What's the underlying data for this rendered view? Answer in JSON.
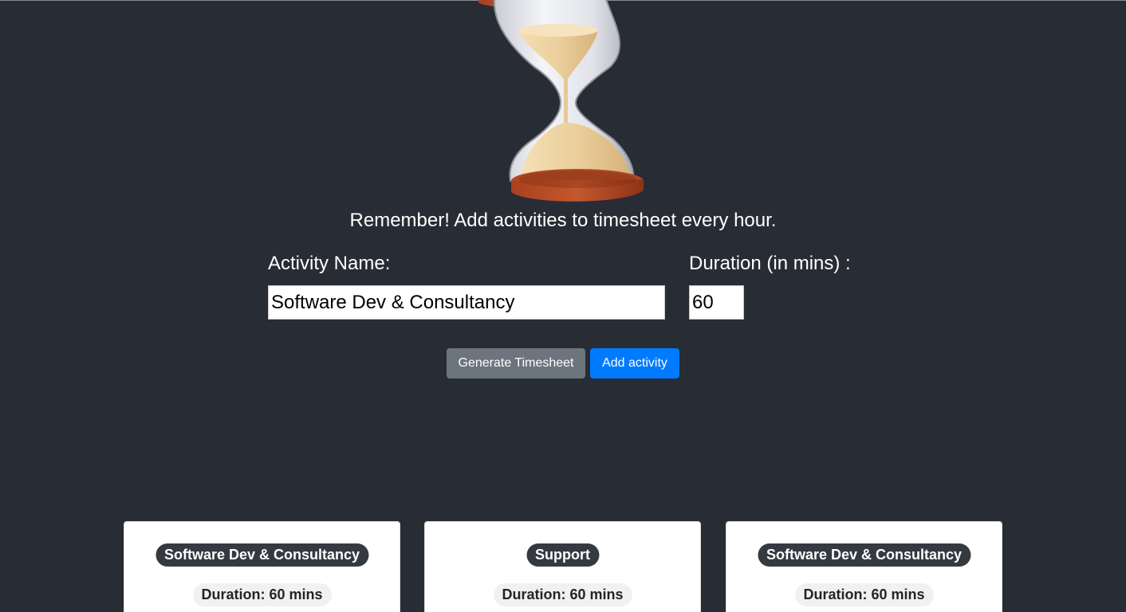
{
  "logo": {
    "icon": "hourglass-icon"
  },
  "reminder": "Remember! Add activities to timesheet every hour.",
  "form": {
    "activity_label": "Activity Name:",
    "activity_value": "Software Dev & Consultancy",
    "duration_label": "Duration (in mins) :",
    "duration_value": "60"
  },
  "buttons": {
    "generate_label": "Generate Timesheet",
    "add_label": "Add activity"
  },
  "activities": [
    {
      "name": "Software Dev & Consultancy",
      "duration": "Duration: 60 mins"
    },
    {
      "name": "Support",
      "duration": "Duration: 60 mins"
    },
    {
      "name": "Software Dev & Consultancy",
      "duration": "Duration: 60 mins"
    }
  ],
  "colors": {
    "background": "#282c34",
    "generate_button": "#6c757d",
    "add_button": "#007bff",
    "name_badge": "#343a40",
    "duration_badge": "#f1f1f1"
  }
}
